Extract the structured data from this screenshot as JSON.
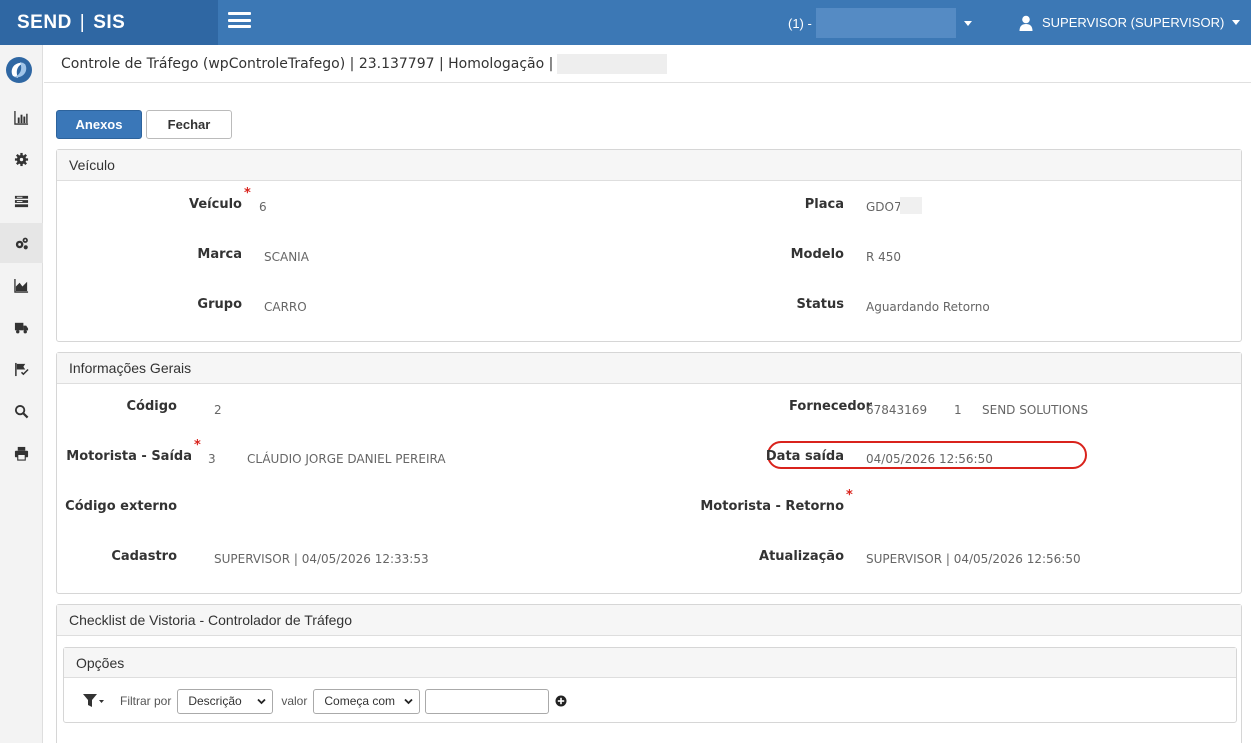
{
  "app": {
    "brand_left": "SEND",
    "brand_sep": "|",
    "brand_right": "SIS"
  },
  "header": {
    "env_label": "(1) -",
    "user_label": "SUPERVISOR (SUPERVISOR)"
  },
  "sidebar": {
    "items": [
      {
        "name": "chart-bar-icon"
      },
      {
        "name": "gear-icon"
      },
      {
        "name": "list-icon"
      },
      {
        "name": "gears-icon"
      },
      {
        "name": "area-chart-icon"
      },
      {
        "name": "truck-icon"
      },
      {
        "name": "flag-check-icon"
      },
      {
        "name": "search-icon"
      },
      {
        "name": "print-icon"
      }
    ]
  },
  "title": {
    "text": "Controle de Tráfego (wpControleTrafego) | 23.137797 | Homologação |"
  },
  "toolbar": {
    "attachments_label": "Anexos",
    "close_label": "Fechar"
  },
  "vehicle": {
    "title": "Veículo",
    "veiculo_label": "Veículo",
    "veiculo_value": "6",
    "placa_label": "Placa",
    "placa_value": "GDO7I",
    "marca_label": "Marca",
    "marca_value": "SCANIA",
    "modelo_label": "Modelo",
    "modelo_value": "R 450",
    "grupo_label": "Grupo",
    "grupo_value": "CARRO",
    "status_label": "Status",
    "status_value": "Aguardando Retorno"
  },
  "general": {
    "title": "Informações Gerais",
    "codigo_label": "Código",
    "codigo_value": "2",
    "fornecedor_label": "Fornecedor",
    "fornecedor_code": "67843169",
    "fornecedor_num": "1",
    "fornecedor_name": "SEND SOLUTIONS",
    "motorista_saida_label": "Motorista - Saída",
    "motorista_saida_code": "3",
    "motorista_saida_name": "CLÁUDIO JORGE DANIEL PEREIRA",
    "data_saida_label": "Data saída",
    "data_saida_value": "04/05/2026 12:56:50",
    "codigo_externo_label": "Código externo",
    "motorista_retorno_label": "Motorista - Retorno",
    "cadastro_label": "Cadastro",
    "cadastro_value": "SUPERVISOR | 04/05/2026 12:33:53",
    "atualizacao_label": "Atualização",
    "atualizacao_value": "SUPERVISOR | 04/05/2026 12:56:50"
  },
  "checklist": {
    "title": "Checklist de Vistoria - Controlador de Tráfego",
    "options_title": "Opções",
    "filter_label": "Filtrar por",
    "filter_field": "Descrição",
    "value_label": "valor",
    "filter_operator": "Começa com",
    "filter_value": ""
  },
  "colors": {
    "topbar": "#3c78b5",
    "brand": "#2f67a3",
    "primary_button": "#3a77b8",
    "required": "#d9231c"
  }
}
